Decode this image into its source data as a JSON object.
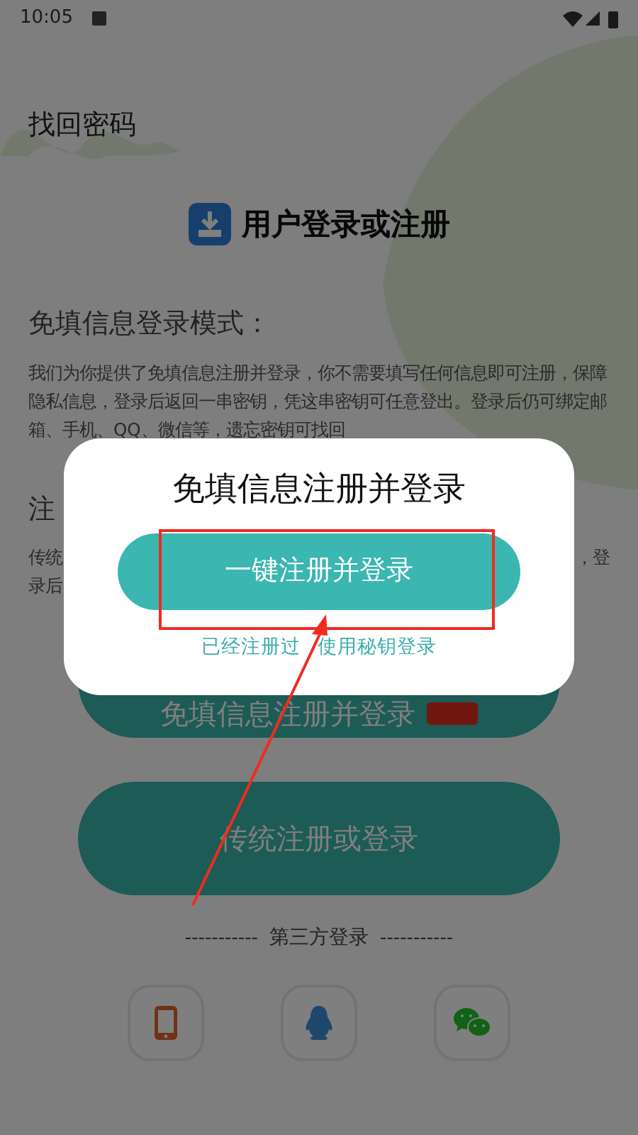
{
  "status_bar": {
    "time": "10:05"
  },
  "header": {
    "link": "找回密码",
    "title": "用户登录或注册"
  },
  "sections": [
    {
      "heading": "免填信息登录模式：",
      "lines": [
        "我们为你提供了免填信息注册并登录，你不需要填写任何信息即可注册，保障隐私信息，登录后返回一串密钥，凭这串密钥可任意登出。登录后仍可绑定邮箱、手机、QQ、微信等，遗忘密钥可找回"
      ]
    },
    {
      "heading": "注",
      "fragments": [
        "传统",
        "，登",
        "录后"
      ]
    }
  ],
  "buttons": [
    {
      "label": "免填信息注册并登录"
    },
    {
      "label": "传统注册或登录"
    }
  ],
  "third_party": {
    "label": "第三方登录",
    "dash": "-----------",
    "options": [
      {
        "kind": "phone"
      },
      {
        "kind": "qq"
      },
      {
        "kind": "wechat"
      }
    ]
  },
  "dialog": {
    "title": "免填信息注册并登录",
    "primary": "一键注册并登录",
    "links": [
      "已经注册过",
      "使用秘钥登录"
    ]
  }
}
